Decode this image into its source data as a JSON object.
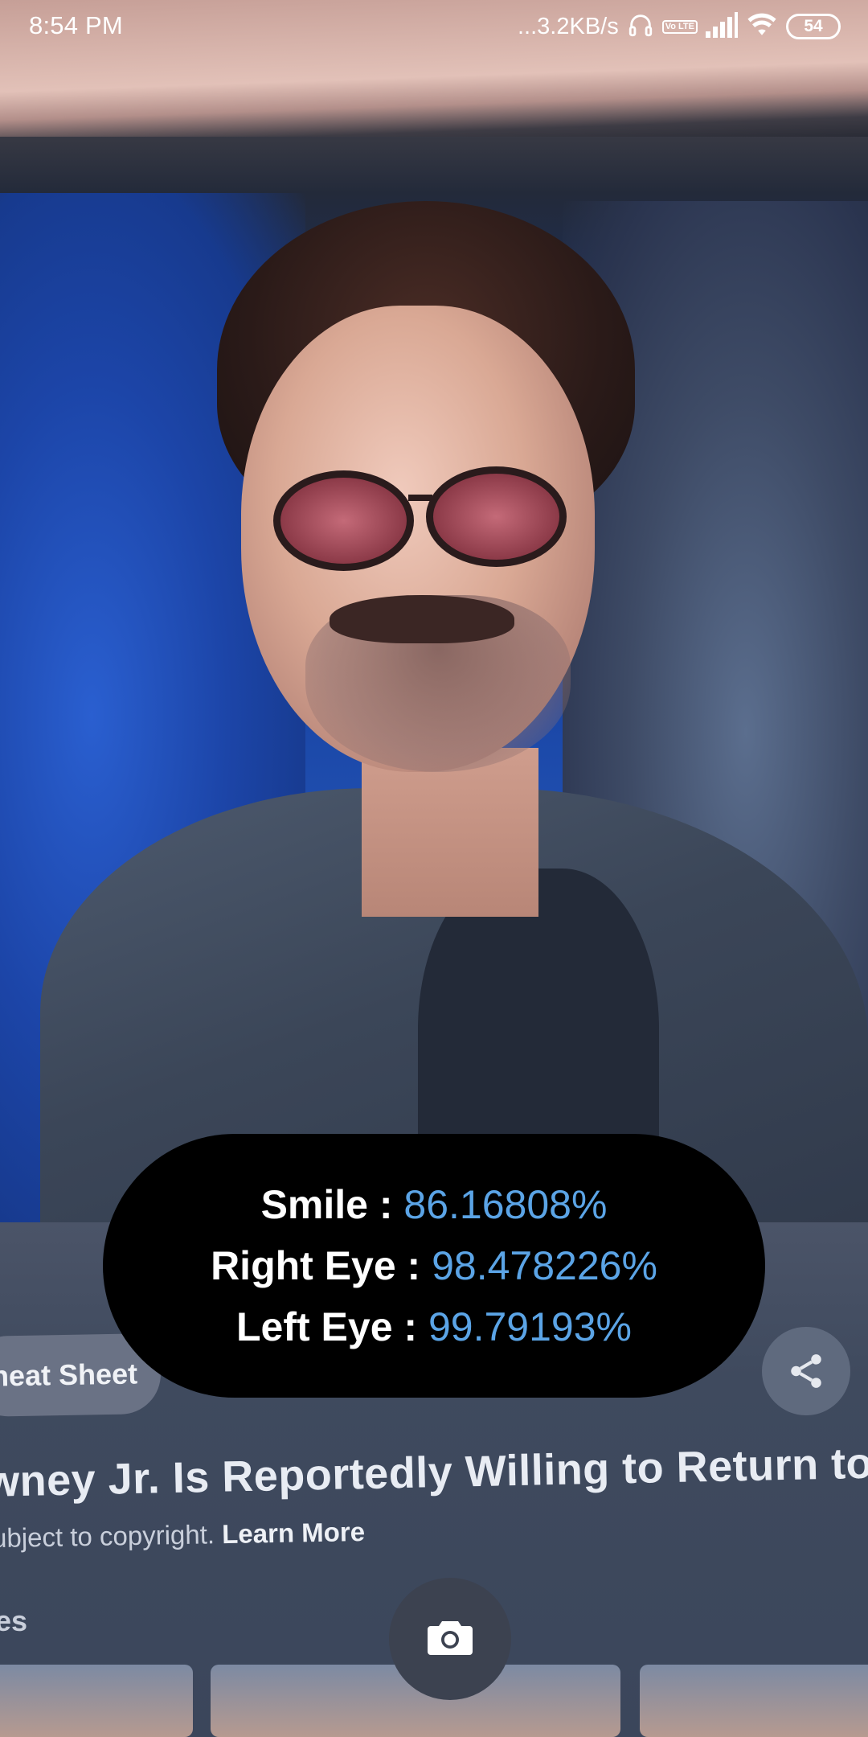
{
  "status_bar": {
    "time": "8:54 PM",
    "network_speed": "...3.2KB/s",
    "volte": "Vo LTE",
    "battery": "54",
    "icons": [
      "headphones-icon",
      "volte-icon",
      "signal-icon",
      "wifi-icon",
      "battery-icon"
    ]
  },
  "camera_view": {
    "background_page": {
      "chip_label": "heat Sheet",
      "headline": "wney Jr. Is Reportedly Willing to Return to",
      "subtext": "ubject to copyright.",
      "learn_more": "Learn More",
      "section_fragment": "es"
    }
  },
  "results": {
    "smile_label": "Smile :",
    "smile_value": "86.16808%",
    "right_eye_label": "Right Eye :",
    "right_eye_value": "98.478226%",
    "left_eye_label": "Left Eye :",
    "left_eye_value": "99.79193%"
  },
  "colors": {
    "value_blue": "#5ba4e6",
    "overlay_bg": "#000000",
    "camera_button_bg": "#3c4250"
  },
  "camera_button": {
    "icon": "camera-icon"
  }
}
